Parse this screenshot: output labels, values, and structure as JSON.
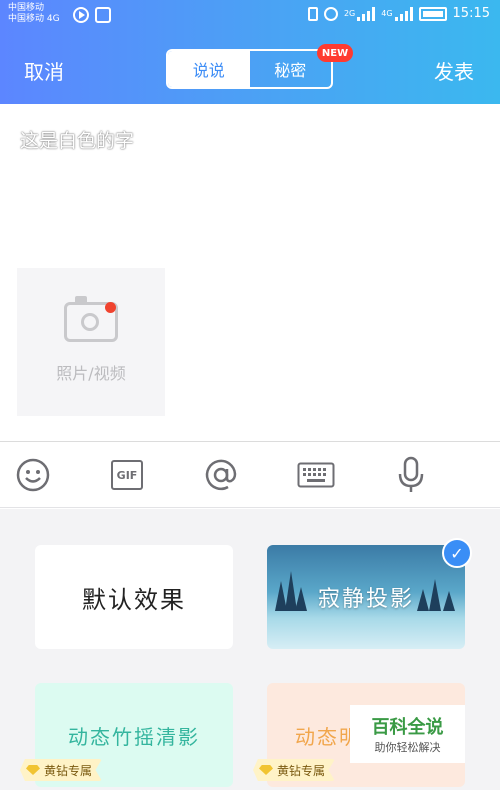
{
  "status": {
    "carrier1": "中国移动",
    "carrier2": "中国移动",
    "net_left": "4G",
    "sig2g": "2G",
    "sig4g": "4G",
    "time": "15:15"
  },
  "header": {
    "cancel": "取消",
    "publish": "发表",
    "tab_say": "说说",
    "tab_secret": "秘密",
    "new_badge": "NEW"
  },
  "editor": {
    "text": "这是白色的字",
    "photo_label": "照片/视频"
  },
  "toolbar": {
    "gif": "GIF"
  },
  "effects": {
    "default": "默认效果",
    "silent": "寂静投影",
    "bamboo": "动态竹摇清影",
    "dynamic2": "动态明",
    "vip_label": "黄钻专属"
  },
  "watermark": {
    "title": "百科全说",
    "subtitle": "助你轻松解决"
  }
}
